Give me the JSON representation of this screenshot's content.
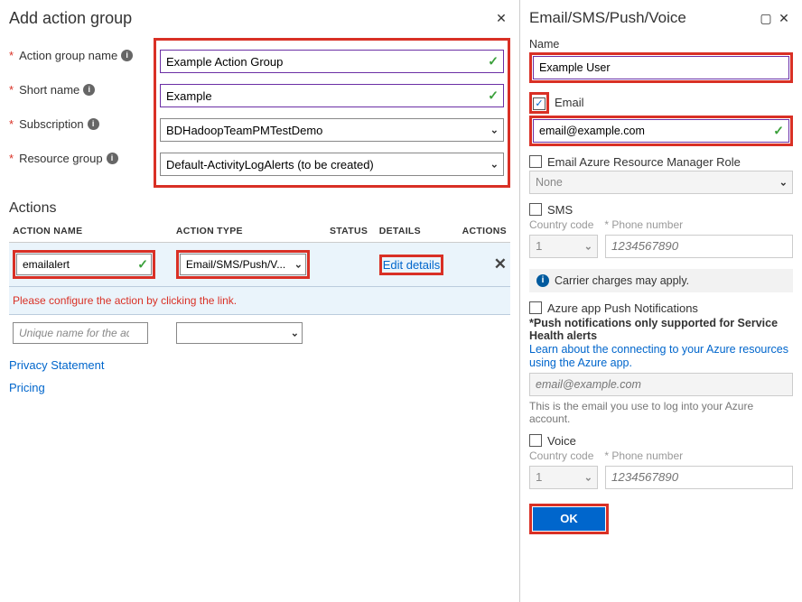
{
  "left": {
    "title": "Add action group",
    "fields": {
      "action_group_name": {
        "label": "Action group name",
        "value": "Example Action Group"
      },
      "short_name": {
        "label": "Short name",
        "value": "Example"
      },
      "subscription": {
        "label": "Subscription",
        "value": "BDHadoopTeamPMTestDemo"
      },
      "resource_group": {
        "label": "Resource group",
        "value": "Default-ActivityLogAlerts (to be created)"
      }
    },
    "actions_title": "Actions",
    "actions_headers": [
      "ACTION NAME",
      "ACTION TYPE",
      "STATUS",
      "DETAILS",
      "ACTIONS"
    ],
    "actions_rows": [
      {
        "name": "emailalert",
        "type": "Email/SMS/Push/V...",
        "details_link": "Edit details"
      }
    ],
    "actions_error": "Please configure the action by clicking the link.",
    "new_action_placeholder": "Unique name for the act...",
    "links": {
      "privacy": "Privacy Statement",
      "pricing": "Pricing"
    }
  },
  "right": {
    "title": "Email/SMS/Push/Voice",
    "name": {
      "label": "Name",
      "value": "Example User"
    },
    "email": {
      "label": "Email",
      "checked": true,
      "value": "email@example.com"
    },
    "arm_role": {
      "label": "Email Azure Resource Manager Role",
      "checked": false,
      "value": "None"
    },
    "sms": {
      "label": "SMS",
      "checked": false,
      "cc_label": "Country code",
      "cc_value": "1",
      "phone_label": "Phone number",
      "phone_placeholder": "1234567890"
    },
    "carrier_note": "Carrier charges may apply.",
    "push": {
      "label": "Azure app Push Notifications",
      "checked": false,
      "note": "*Push notifications only supported for Service Health alerts",
      "link": "Learn about the connecting to your Azure resources using the Azure app.",
      "email_placeholder": "email@example.com",
      "hint": "This is the email you use to log into your Azure account."
    },
    "voice": {
      "label": "Voice",
      "checked": false,
      "cc_label": "Country code",
      "cc_value": "1",
      "phone_label": "Phone number",
      "phone_placeholder": "1234567890"
    },
    "ok": "OK"
  }
}
